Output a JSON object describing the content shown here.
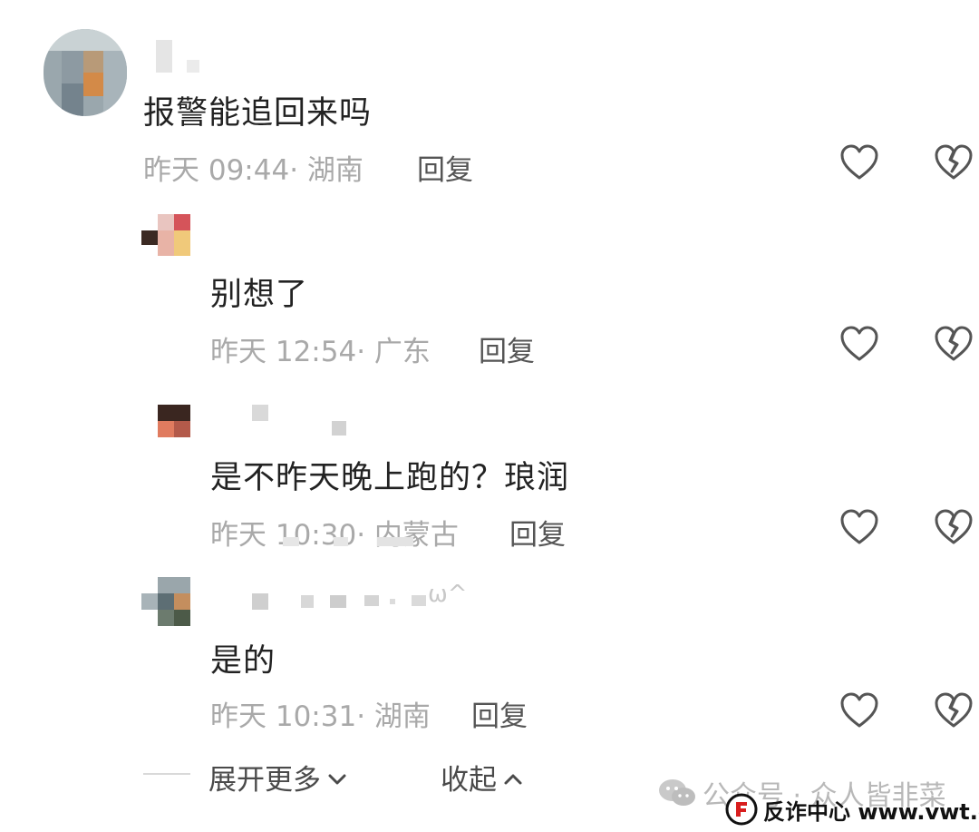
{
  "comments": [
    {
      "text": "报警能追回来吗",
      "meta": "昨天 09:44· 湖南",
      "reply": "回复"
    },
    {
      "text": "别想了",
      "meta": "昨天 12:54· 广东",
      "reply": "回复"
    },
    {
      "text": "是不昨天晚上跑的？琅润",
      "meta": "昨天 10:30· 内蒙古",
      "reply": "回复"
    },
    {
      "text": "是的",
      "meta": "昨天 10:31· 湖南",
      "reply": "回复",
      "name_suffix": "ω^"
    }
  ],
  "footer": {
    "expand": "展开更多",
    "collapse": "收起"
  },
  "watermark": {
    "text": "公众号 · 众人皆非菜"
  },
  "brand": {
    "text": "反诈中心 www.vwt.cc"
  },
  "icons": {
    "like": "heart-outline-icon",
    "dislike": "broken-heart-icon",
    "expand": "chevron-down-icon",
    "collapse": "chevron-up-icon"
  }
}
